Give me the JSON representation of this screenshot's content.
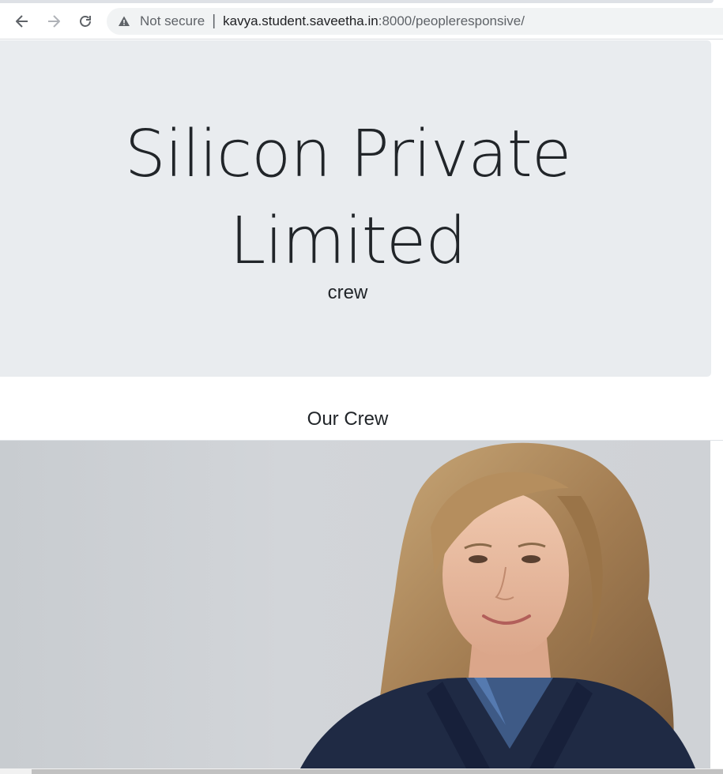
{
  "browser": {
    "not_secure": "Not secure",
    "url_host": "kavya.student.saveetha.in",
    "url_path": ":8000/peopleresponsive/",
    "icons": [
      "back-arrow-icon",
      "forward-arrow-icon",
      "reload-icon",
      "warning-icon"
    ]
  },
  "hero": {
    "title": "Silicon Private Limited",
    "subtitle": "crew",
    "background": "#e9ecef"
  },
  "section": {
    "heading": "Our Crew"
  },
  "photo": {
    "subject": "portrait-photo"
  }
}
